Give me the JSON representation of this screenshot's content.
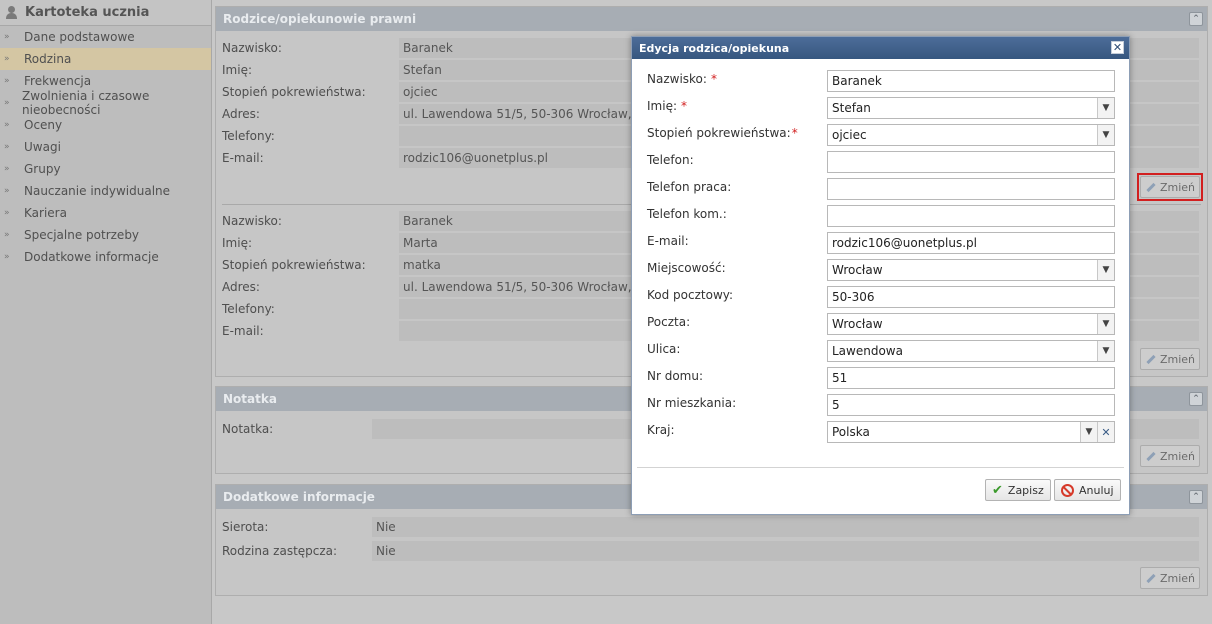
{
  "sidebar": {
    "title": "Kartoteka ucznia",
    "items": [
      {
        "label": "Dane podstawowe"
      },
      {
        "label": "Rodzina"
      },
      {
        "label": "Frekwencja"
      },
      {
        "label": "Zwolnienia i czasowe nieobecności"
      },
      {
        "label": "Oceny"
      },
      {
        "label": "Uwagi"
      },
      {
        "label": "Grupy"
      },
      {
        "label": "Nauczanie indywidualne"
      },
      {
        "label": "Kariera"
      },
      {
        "label": "Specjalne potrzeby"
      },
      {
        "label": "Dodatkowe informacje"
      }
    ],
    "chevron": "»"
  },
  "parents_panel": {
    "title": "Rodzice/opiekunowie prawni",
    "collapse": "⌃",
    "edit_label": "Zmień",
    "labels": {
      "surname": "Nazwisko:",
      "first_name": "Imię:",
      "relation": "Stopień pokrewieństwa:",
      "address": "Adres:",
      "phones": "Telefony:",
      "email": "E-mail:"
    },
    "parent1": {
      "surname": "Baranek",
      "first_name": "Stefan",
      "relation": "ojciec",
      "address": "ul. Lawendowa 51/5, 50-306 Wrocław, Pols",
      "phones": "",
      "email": "rodzic106@uonetplus.pl"
    },
    "parent2": {
      "surname": "Baranek",
      "first_name": "Marta",
      "relation": "matka",
      "address": "ul. Lawendowa 51/5, 50-306 Wrocław, Pols",
      "phones": "",
      "email": ""
    }
  },
  "note_panel": {
    "title": "Notatka",
    "label": "Notatka:",
    "value": "",
    "edit_label": "Zmień"
  },
  "extra_panel": {
    "title": "Dodatkowe informacje",
    "orphan_label": "Sierota:",
    "orphan_value": "Nie",
    "foster_label": "Rodzina zastępcza:",
    "foster_value": "Nie",
    "edit_label": "Zmień"
  },
  "dialog": {
    "title": "Edycja rodzica/opiekuna",
    "close": "✕",
    "required_mark": "*",
    "fields": {
      "surname": {
        "label": "Nazwisko:",
        "value": "Baranek"
      },
      "first_name": {
        "label": "Imię:",
        "value": "Stefan"
      },
      "relation": {
        "label": "Stopień pokrewieństwa:",
        "value": "ojciec"
      },
      "phone": {
        "label": "Telefon:",
        "value": ""
      },
      "work_phone": {
        "label": "Telefon praca:",
        "value": ""
      },
      "mobile_phone": {
        "label": "Telefon kom.:",
        "value": ""
      },
      "email": {
        "label": "E-mail:",
        "value": "rodzic106@uonetplus.pl"
      },
      "city": {
        "label": "Miejscowość:",
        "value": "Wrocław"
      },
      "postal_code": {
        "label": "Kod pocztowy:",
        "value": "50-306"
      },
      "post_office": {
        "label": "Poczta:",
        "value": "Wrocław"
      },
      "street": {
        "label": "Ulica:",
        "value": "Lawendowa"
      },
      "house_no": {
        "label": "Nr domu:",
        "value": "51"
      },
      "apartment_no": {
        "label": "Nr mieszkania:",
        "value": "5"
      },
      "country": {
        "label": "Kraj:",
        "value": "Polska"
      }
    },
    "save_label": "Zapisz",
    "cancel_label": "Anuluj",
    "dropdown_glyph": "▼",
    "clear_glyph": "✕",
    "ok_glyph": "✔"
  }
}
